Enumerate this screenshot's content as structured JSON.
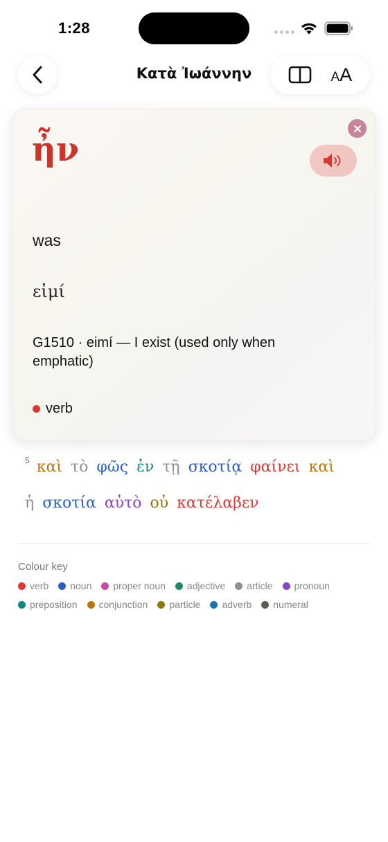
{
  "status": {
    "time": "1:28"
  },
  "nav": {
    "title": "Κατὰ Ἰωάννην",
    "text_size_small": "A",
    "text_size_large": "A"
  },
  "card": {
    "headword": "ἦν",
    "gloss": "was",
    "lemma": "εἰμί",
    "strongs": "G1510 · eimí — I exist (used only when emphatic)",
    "pos": "verb",
    "pos_color": "#d63a30"
  },
  "verse": {
    "number": "5",
    "lines": [
      [
        {
          "text": "καὶ",
          "color": "#b8760f"
        },
        {
          "text": "τὸ",
          "color": "#8e8e96"
        },
        {
          "text": "φῶς",
          "color": "#2d5fc0"
        },
        {
          "text": "ἐν",
          "color": "#13877f"
        },
        {
          "text": "τῇ",
          "color": "#8e8e96"
        },
        {
          "text": "σκοτίᾳ",
          "color": "#2d5fc0"
        },
        {
          "text": "φαίνει",
          "color": "#d63a30"
        },
        {
          "text": "καὶ",
          "color": "#b8760f"
        }
      ],
      [
        {
          "text": "ἡ",
          "color": "#8e8e96"
        },
        {
          "text": "σκοτία",
          "color": "#2d5fc0"
        },
        {
          "text": "αὐτὸ",
          "color": "#8a44c8"
        },
        {
          "text": "οὐ",
          "color": "#8a7a14"
        },
        {
          "text": "κατέλαβεν",
          "color": "#d63a30"
        }
      ]
    ]
  },
  "colour_key": {
    "title": "Colour key",
    "rows": [
      [
        {
          "label": "verb",
          "color": "#d63a30"
        },
        {
          "label": "noun",
          "color": "#2d5fc0"
        },
        {
          "label": "proper noun",
          "color": "#c94aa0"
        },
        {
          "label": "adjective",
          "color": "#1f8a5c"
        },
        {
          "label": "article",
          "color": "#8e8e96"
        },
        {
          "label": "pronoun",
          "color": "#8a44c8"
        }
      ],
      [
        {
          "label": "preposition",
          "color": "#13877f"
        },
        {
          "label": "conjunction",
          "color": "#b8760f"
        },
        {
          "label": "particle",
          "color": "#8a7a14"
        },
        {
          "label": "adverb",
          "color": "#1b73a8"
        },
        {
          "label": "numeral",
          "color": "#5e5a56"
        }
      ]
    ]
  }
}
